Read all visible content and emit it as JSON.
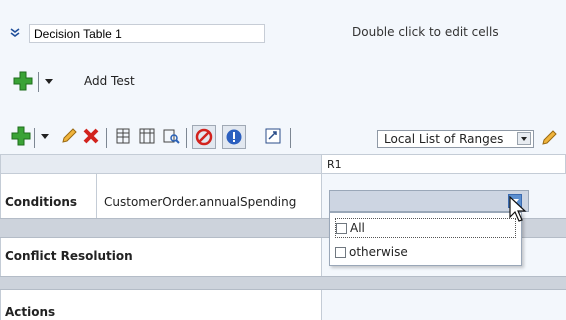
{
  "header": {
    "table_name": "Decision Table 1",
    "hint": "Double click to edit cells"
  },
  "tests": {
    "add_test_label": "Add Test"
  },
  "toolbar": {
    "range_select_value": "Local List of Ranges"
  },
  "grid": {
    "column_header": "R1",
    "conditions_label": "Conditions",
    "condition_expression": "CustomerOrder.annualSpending",
    "conflict_resolution_label": "Conflict Resolution",
    "actions_label": "Actions"
  },
  "dropdown": {
    "options": [
      "All",
      "otherwise"
    ]
  }
}
